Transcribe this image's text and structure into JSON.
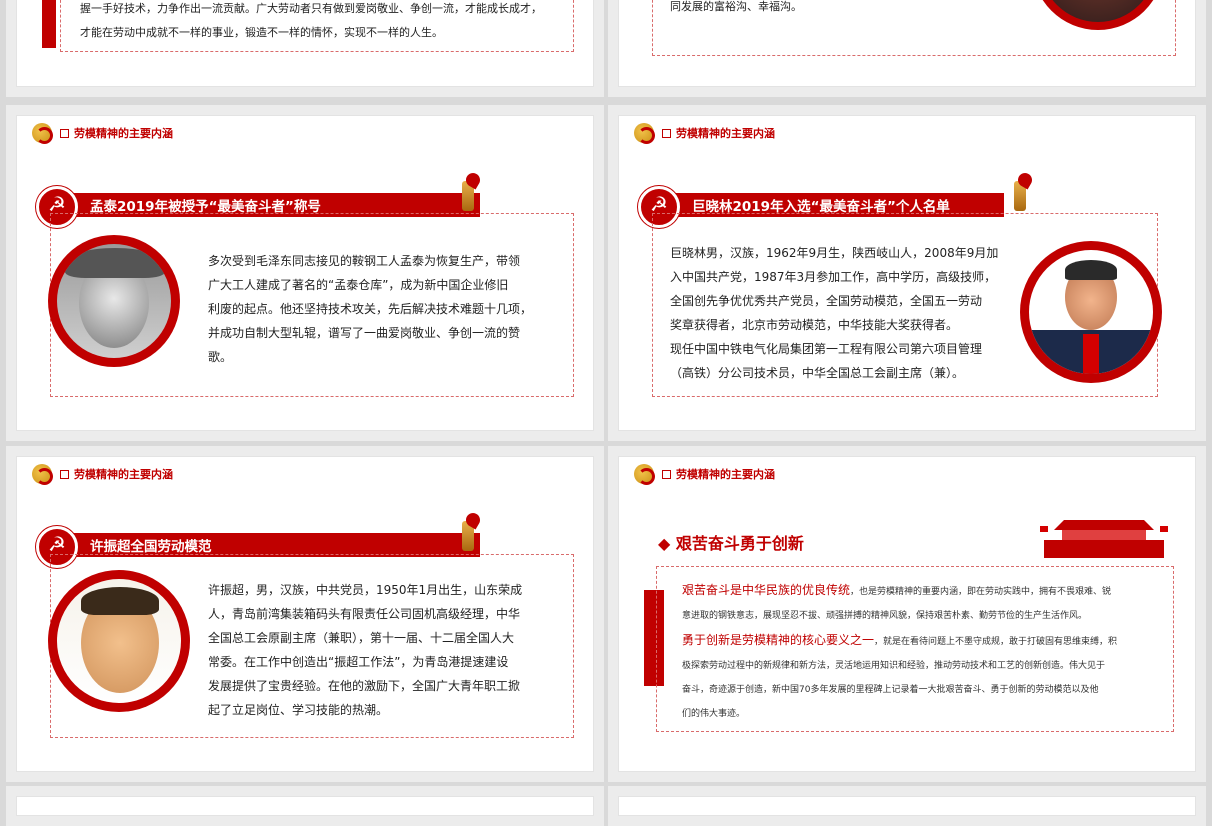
{
  "slide_title": "劳模精神的主要内涵",
  "top_left": {
    "line1": "握一手好技术，力争作出一流贡献。广大劳动者只有做到爱岗敬业、争创一流，才能成长成才，",
    "line2": "才能在劳动中成就不一样的事业，锻造不一样的情怀，实现不一样的人生。"
  },
  "top_right": {
    "line1": "同发展的富裕沟、幸福沟。"
  },
  "slide_a": {
    "banner": "孟泰2019年被授予“最美奋斗者”称号",
    "lines": [
      "多次受到毛泽东同志接见的鞍钢工人孟泰为恢复生产，带领",
      "广大工人建成了著名的“孟泰仓库”，成为新中国企业修旧",
      "利废的起点。他还坚持技术攻关，先后解决技术难题十几项，",
      "并成功自制大型轧辊，谱写了一曲爱岗敬业、争创一流的赞",
      "歌。"
    ]
  },
  "slide_b": {
    "banner": "巨晓林2019年入选“最美奋斗者”个人名单",
    "lines": [
      "巨晓林男，汉族，1962年9月生，陕西岐山人，2008年9月加",
      "入中国共产党，1987年3月参加工作，高中学历，高级技师，",
      "全国创先争优优秀共产党员，全国劳动模范，全国五一劳动",
      "奖章获得者，北京市劳动模范，中华技能大奖获得者。",
      "现任中国中铁电气化局集团第一工程有限公司第六项目管理",
      "（高铁）分公司技术员，中华全国总工会副主席（兼）。"
    ]
  },
  "slide_c": {
    "banner": "许振超全国劳动模范",
    "lines": [
      "许振超，男，汉族，中共党员，1950年1月出生，山东荣成",
      "人，青岛前湾集装箱码头有限责任公司固机高级经理，中华",
      "全国总工会原副主席（兼职），第十一届、十二届全国人大",
      "常委。在工作中创造出“振超工作法”，为青岛港提速建设",
      "发展提供了宝贵经验。在他的激励下，全国广大青年职工掀",
      "起了立足岗位、学习技能的热潮。"
    ]
  },
  "slide_d": {
    "heading": "◆ 艰苦奋斗勇于创新",
    "p1_red": "艰苦奋斗是中华民族的优良传统",
    "p1_rest": "，也是劳模精神的重要内涵，即在劳动实践中，拥有不畏艰难、锐",
    "p1_line2": "意进取的钢铁意志，展现坚忍不拔、顽强拼搏的精神风貌，保持艰苦朴素、勤劳节俭的生产生活作风。",
    "p2_red": "勇于创新是劳模精神的核心要义之一",
    "p2_rest": "，就是在看待问题上不墨守成规，敢于打破固有思维束缚，积",
    "p2_line2": "极探索劳动过程中的新规律和新方法，灵活地运用知识和经验，推动劳动技术和工艺的创新创造。伟大见于",
    "p2_line3": "奋斗，奇迹源于创造，新中国70多年发展的里程碑上记录着一大批艰苦奋斗、勇于创新的劳动模范以及他",
    "p2_line4": "们的伟大事迹。"
  },
  "colors": {
    "accent": "#c00000",
    "dashed": "#d96b6b"
  }
}
